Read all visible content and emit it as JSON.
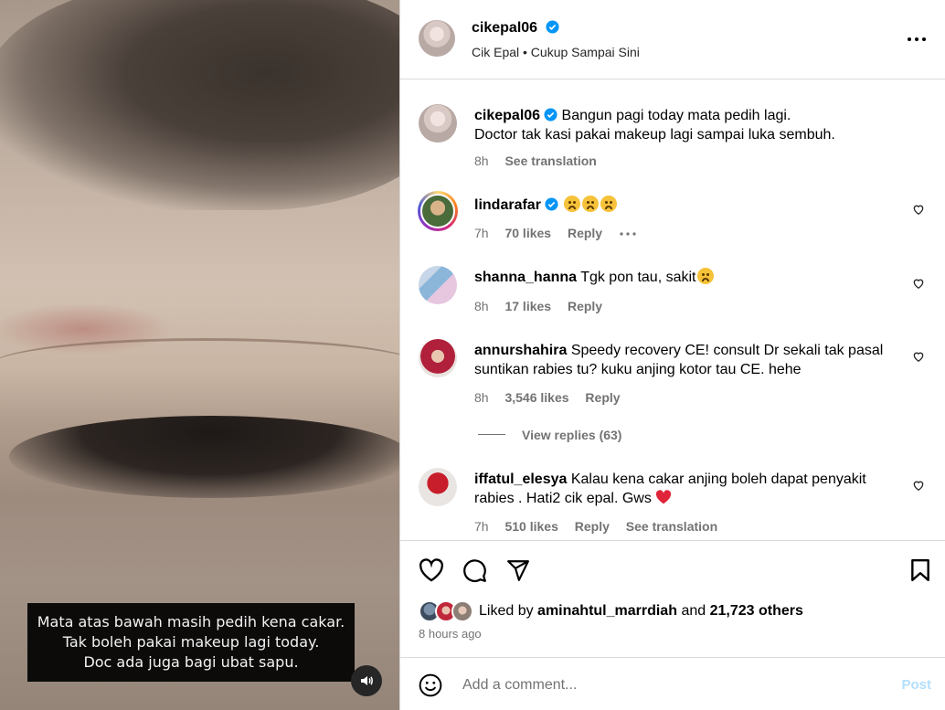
{
  "media": {
    "caption_lines": [
      "Mata atas bawah masih pedih kena cakar.",
      "Tak boleh pakai makeup lagi today.",
      "Doc ada juga bagi ubat sapu."
    ]
  },
  "header": {
    "username": "cikepal06",
    "subtitle": "Cik Epal • Cukup Sampai Sini"
  },
  "caption": {
    "username": "cikepal06",
    "text_line1": "Bangun pagi today mata pedih lagi.",
    "text_line2": "Doctor tak kasi pakai makeup lagi sampai luka sembuh.",
    "time": "8h",
    "see_translation": "See translation"
  },
  "comments": [
    {
      "username": "lindarafar",
      "text": "",
      "time": "7h",
      "likes": "70 likes",
      "reply": "Reply"
    },
    {
      "username": "shanna_hanna",
      "text": "Tgk pon tau, sakit",
      "time": "8h",
      "likes": "17 likes",
      "reply": "Reply"
    },
    {
      "username": "annurshahira",
      "text": "Speedy recovery CE! consult Dr sekali tak pasal suntikan rabies tu? kuku anjing kotor tau CE. hehe",
      "time": "8h",
      "likes": "3,546 likes",
      "reply": "Reply",
      "view_replies": "View replies (63)"
    },
    {
      "username": "iffatul_elesya",
      "text": "Kalau kena cakar anjing boleh dapat penyakit rabies . Hati2 cik epal. Gws",
      "time": "7h",
      "likes": "510 likes",
      "reply": "Reply",
      "see_translation": "See translation"
    }
  ],
  "likes": {
    "prefix": "Liked by",
    "user": "aminahtul_marrdiah",
    "middle": "and",
    "others": "21,723 others",
    "time": "8 hours ago"
  },
  "add_comment": {
    "placeholder": "Add a comment...",
    "post": "Post"
  },
  "colors": {
    "verified": "#0095f6",
    "heart": "#ed1c24",
    "post_disabled": "#b2dffc"
  }
}
